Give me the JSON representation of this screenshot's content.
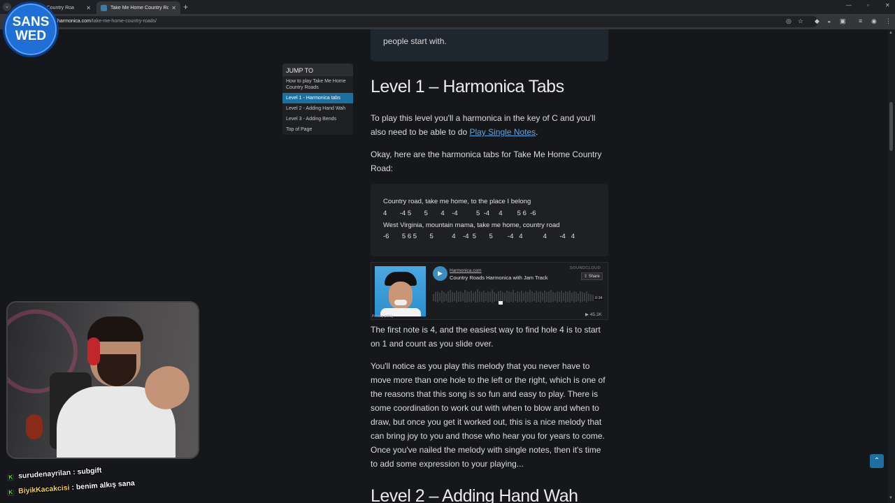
{
  "browser": {
    "tabs": [
      {
        "title": "Home Country Roa",
        "active": false
      },
      {
        "title": "Take Me Home Country Roads",
        "active": true
      }
    ],
    "new_tab": "+",
    "url_host": "harmonica.com",
    "url_path": "/take-me-home-country-roads/"
  },
  "page": {
    "prev_box_text": "people start with.",
    "toc": {
      "heading": "JUMP TO",
      "items": [
        {
          "label": "How to play Take Me Home Country Roads",
          "active": false
        },
        {
          "label": "Level 1 - Harmonica tabs",
          "active": true
        },
        {
          "label": "Level 2 - Adding Hand Wah",
          "active": false
        },
        {
          "label": "Level 3 - Adding Bends",
          "active": false
        },
        {
          "label": "Top of Page",
          "active": false
        }
      ]
    },
    "heading_level1": "Level 1 – Harmonica Tabs",
    "para1_before": "To play this level you'll a harmonica in the key of C and you'll also need to be able to do ",
    "para1_link": "Play Single Notes",
    "para1_after": ".",
    "para2": "Okay, here are the harmonica tabs for Take Me Home Country Road:",
    "tabs_lines": [
      "Country road, take me home, to the place I belong",
      "4       -4 5       5       4    -4          5  -4     4        5 6  -6",
      "West Virginia, mountain mama, take me home, country road",
      "-6       5 6 5       5          4    -4  5       5        -4   4           4       -4   4"
    ],
    "player": {
      "artist": "Harmonica.com",
      "track": "Country Roads Harmonica with Jam Track",
      "logo": "SOUNDCLOUD",
      "share": "Share",
      "time": "0:34",
      "plays": "▶ 45.3K",
      "privacy": "Privacy policy"
    },
    "para3": "The first note is 4, and the easiest way to find hole 4 is to start on 1 and count as you slide over.",
    "para4": "You'll notice as you play this melody that you never have to move more than one hole to the left or the right, which is one of the reasons that this song is so fun and easy to play. There is some coordination to work out with when to blow and when to draw, but once you get it worked out, this is a nice melody that can bring joy to you and those who hear you for years to come. Once you've nailed the melody with single notes, then it's time to add some expression to your playing...",
    "heading_level2": "Level 2 – Adding Hand Wah"
  },
  "overlay": {
    "logo_line1": "SANS",
    "logo_line2": "WED",
    "chat": [
      {
        "user": "surudenayrilan",
        "sep": " : ",
        "message": "subgift"
      },
      {
        "user": "BiyikKacakcisi",
        "sep": " : ",
        "message": "benim alkış sana"
      }
    ]
  },
  "colors": {
    "accent": "#1d6fa0",
    "link": "#5aa8e6",
    "background": "#16171b",
    "kick_green": "#53fc18"
  }
}
